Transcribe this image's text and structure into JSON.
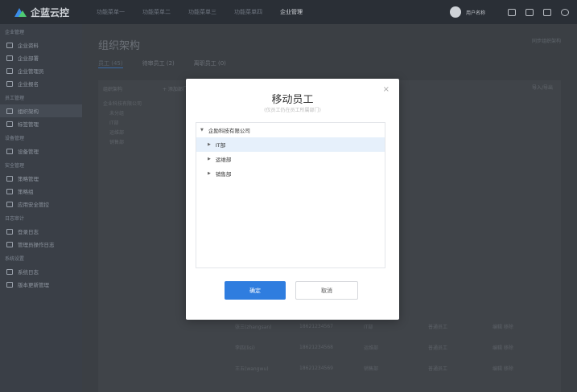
{
  "app": {
    "name": "企蓝云控"
  },
  "topnav": {
    "items": [
      "功能菜单一",
      "功能菜单二",
      "功能菜单三",
      "功能菜单四",
      "企业管理"
    ],
    "user": "用户名称",
    "icons": [
      "bell-icon",
      "grid-icon",
      "window-icon",
      "power-icon"
    ]
  },
  "sidebar": {
    "groups": [
      {
        "title": "企业管理",
        "items": [
          "企业资料",
          "企业部署",
          "企业管理员",
          "企业报名"
        ]
      },
      {
        "title": "员工管理",
        "items": [
          "组织架构",
          "标签管理"
        ]
      },
      {
        "title": "设备管理",
        "items": [
          "设备管理"
        ]
      },
      {
        "title": "安全管理",
        "items": [
          "策略管理",
          "策略组",
          "应用安全管控"
        ]
      },
      {
        "title": "日志审计",
        "items": [
          "登录日志",
          "管理员操作日志"
        ]
      },
      {
        "title": "系统设置",
        "items": [
          "系统日志",
          "版本更新管理"
        ]
      }
    ]
  },
  "page": {
    "title": "组织架构",
    "tabs": [
      "员工 (45)",
      "待审员工 (2)",
      "离职员工 (0)"
    ],
    "sync_link": "同步组织架构",
    "tree_header": "组织架构",
    "tree_add": "+ 添加部门",
    "import_btn": "导入/导出",
    "tree": [
      "企业科技有限公司",
      "未分组",
      "IT部",
      "运维部",
      "销售部"
    ]
  },
  "background_table": {
    "rows": [
      [
        "张三(zhangsan)",
        "18621234567",
        "IT部",
        "普通员工",
        "编辑 移除"
      ],
      [
        "李四(lisi)",
        "18621234568",
        "运维部",
        "普通员工",
        "编辑 移除"
      ],
      [
        "王五(wangwu)",
        "18621234569",
        "销售部",
        "普通员工",
        "编辑 移除"
      ]
    ]
  },
  "modal": {
    "title": "移动员工",
    "subtitle": "(仅员工仍在员工所属部门)",
    "close": "×",
    "tree": {
      "root": "企励科技有限公司",
      "children": [
        "IT部",
        "运维部",
        "销售部"
      ],
      "selected": "IT部"
    },
    "confirm_label": "确定",
    "cancel_label": "取消"
  },
  "colors": {
    "primary": "#2f7ddf",
    "selected_bg": "#e6f0fb",
    "topbar": "#2a2f36",
    "sidebar": "#3a3f47"
  }
}
